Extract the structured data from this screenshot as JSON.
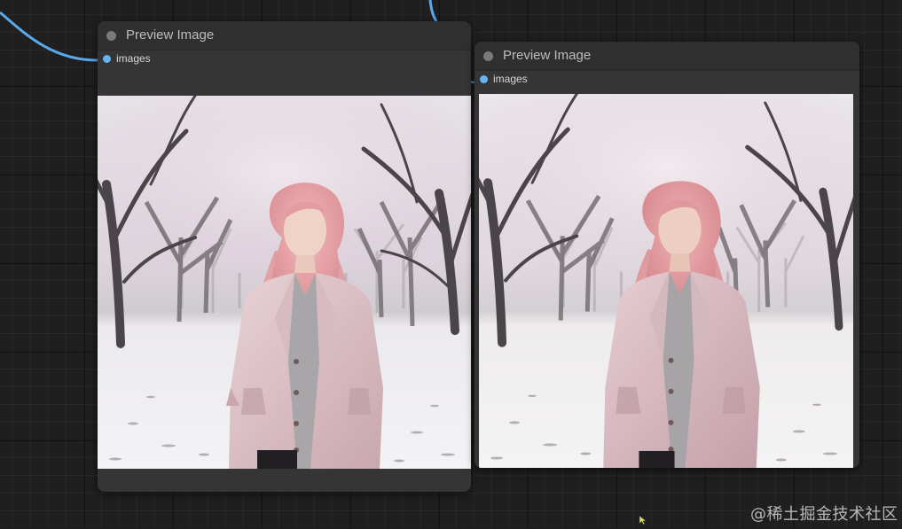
{
  "nodes": [
    {
      "title": "Preview Image",
      "input_label": "images",
      "image_alt": "Woman with pink wavy hair in a pink coat standing in a snowy park with bare trees"
    },
    {
      "title": "Preview Image",
      "input_label": "images",
      "image_alt": "Woman with pink wavy hair in a pink coat standing in a snowy park with bare trees"
    }
  ],
  "watermark": "@稀土掘金技术社区",
  "colors": {
    "canvas_bg": "#1f1f1f",
    "node_bg": "#353535",
    "node_title_bg": "#2f2f2f",
    "image_link": "#64b5f6",
    "title_dot": "#7a7a7a"
  },
  "icons": {
    "title_dot": "circle-icon",
    "input_slot": "circle-icon",
    "cursor": "pointer-cursor-icon"
  }
}
